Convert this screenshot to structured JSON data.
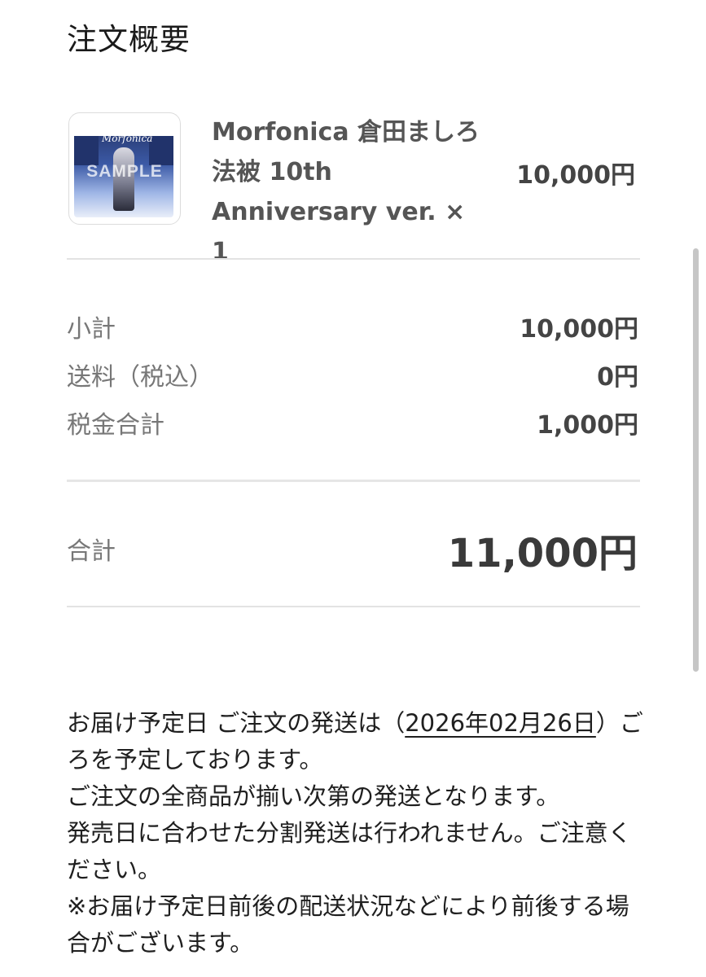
{
  "page": {
    "title": "注文概要"
  },
  "line_item": {
    "name": "Morfonica 倉田ましろ 法被 10th Anniversary ver. × 1",
    "price": "10,000円",
    "thumbnail": {
      "watermark": "SAMPLE",
      "script_text": "Morfonica"
    }
  },
  "summary": {
    "subtotal_label": "小計",
    "subtotal_value": "10,000円",
    "shipping_label": "送料（税込）",
    "shipping_value": "0円",
    "tax_label": "税金合計",
    "tax_value": "1,000円"
  },
  "total": {
    "label": "合計",
    "value": "11,000円"
  },
  "notice": {
    "line1_prefix": "お届け予定日 ご注文の発送は（",
    "delivery_date": "2026年02月26日",
    "line1_suffix": "）ごろを予定しております。",
    "line2": "ご注文の全商品が揃い次第の発送となります。",
    "line3": "発売日に合わせた分割発送は行われません。ご注意ください。",
    "line4": "※お届け予定日前後の配送状況などにより前後する場合がございます。"
  },
  "colors": {
    "text_primary": "#1f1f1f",
    "text_secondary": "#777777",
    "divider": "#e3e3e3"
  }
}
